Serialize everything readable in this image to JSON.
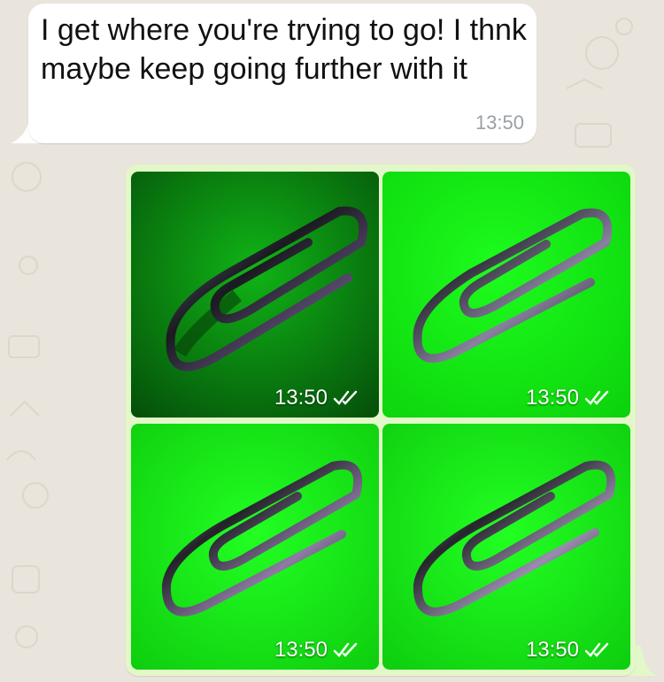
{
  "incoming": {
    "text": "I get where you're trying to go! I thnk maybe keep going further with it",
    "time": "13:50"
  },
  "outgoing": {
    "images": [
      {
        "time": "13:50",
        "icon": "double-check-read-icon",
        "description": "paperclip on dark green"
      },
      {
        "time": "13:50",
        "icon": "double-check-read-icon",
        "description": "paperclip on green"
      },
      {
        "time": "13:50",
        "icon": "double-check-read-icon",
        "description": "paperclip on green"
      },
      {
        "time": "13:50",
        "icon": "double-check-read-icon",
        "description": "paperclip on green"
      }
    ]
  },
  "colors": {
    "wallpaper": "#e9e4dc",
    "incoming_bubble": "#ffffff",
    "outgoing_bubble": "#e3f8c9",
    "tile_dark_green": "#0b8a10",
    "tile_bright_green": "#12f212"
  }
}
